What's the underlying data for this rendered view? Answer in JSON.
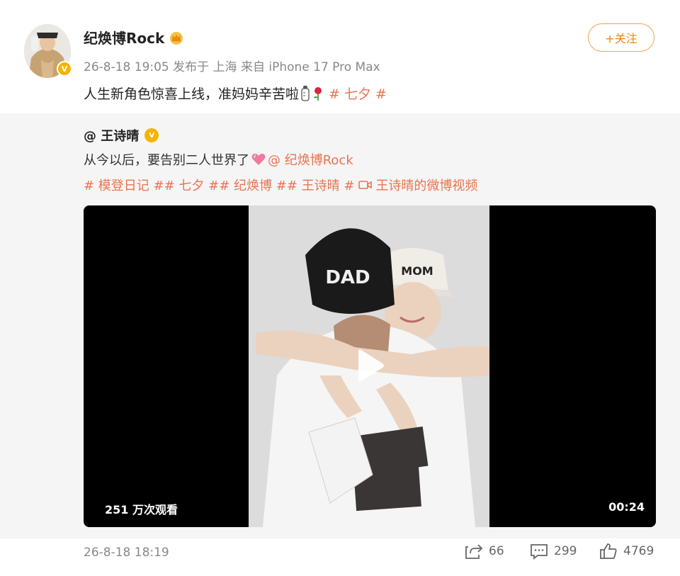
{
  "author": {
    "name": "纪焕博Rock",
    "meta": "26-8-18 19:05 发布于 上海 来自 iPhone 17 Pro Max",
    "follow_label": "+关注"
  },
  "post": {
    "text": "人生新角色惊喜上线，准妈妈辛苦啦",
    "topic": "# 七夕 #"
  },
  "repost": {
    "user": "@ 王诗晴",
    "text": "从今以后，要告别二人世界了",
    "mention": "@ 纪焕博Rock",
    "tags": "# 模登日记 ## 七夕 ## 纪焕博 ## 王诗晴 #",
    "video_link": "王诗晴的微博视频",
    "video": {
      "views": "251 万次观看",
      "duration": "00:24",
      "cap_dad": "DAD",
      "cap_mom": "MOM"
    },
    "date": "26-8-18 18:19",
    "stats": {
      "shares": "66",
      "comments": "299",
      "likes": "4769"
    }
  },
  "colors": {
    "accent": "#eb7350",
    "follow": "#e8870f",
    "verified": "#f5b400"
  }
}
